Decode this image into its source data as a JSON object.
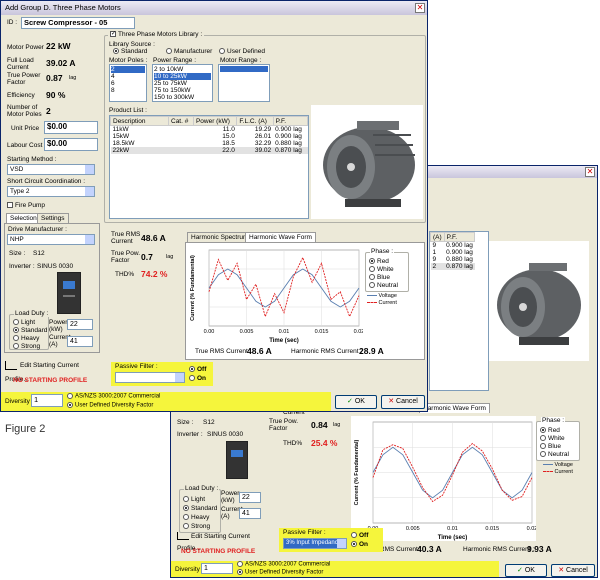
{
  "win1": {
    "title": "Add Group D. Three Phase Motors",
    "id_label": "ID :",
    "id_value": "Screw Compressor - 05",
    "motor_power_label": "Motor Power",
    "motor_power_value": "22 kW",
    "flc_label1": "Full Load",
    "flc_label2": "Current",
    "flc_value": "39.02 A",
    "tpf_label1": "True Power",
    "tpf_label2": "Factor",
    "tpf_value": "0.87",
    "tpf_unit": "lag",
    "eff_label": "Efficiency",
    "eff_value": "90 %",
    "nmp_label1": "Number of",
    "nmp_label2": "Motor Poles",
    "nmp_value": "2",
    "unit_price_label": "Unit Price",
    "unit_price_value": "$0.00",
    "labour_label": "Labour Cost",
    "labour_value": "$0.00",
    "starting_method_label": "Starting Method :",
    "starting_method_value": "VSD",
    "scc_label": "Short Circuit Coordination :",
    "scc_value": "Type 2",
    "fire_pump_label": "Fire Pump",
    "tab_selection": "Selection",
    "tab_settings": "Settings",
    "drive_mfr_label": "Drive Manufacturer :",
    "drive_mfr_value": "NHP",
    "size_label": "Size :",
    "size_value": "S12",
    "inverter_label": "Inverter :",
    "inverter_value": "SINUS 0030",
    "load_duty_label": "Load Duty :",
    "load_options": [
      "Light",
      "Standard",
      "Heavy",
      "Strong"
    ],
    "power_label1": "Power",
    "power_label2": "(kW)",
    "power_value": "22",
    "current_label1": "Current",
    "current_label2": "(A)",
    "current_value": "41",
    "edit_profile_label": "Edit Starting Current Profile...",
    "no_profile": "NO STARTING PROFILE",
    "library_check_label": "Three Phase Motors Library :",
    "library_source_label": "Library Source :",
    "lib_standard": "Standard",
    "lib_manufacturer": "Manufacturer",
    "lib_user": "User Defined",
    "motor_poles_label": "Motor Poles :",
    "motor_poles": [
      "2",
      "4",
      "6",
      "8"
    ],
    "power_range_label": "Power Range :",
    "power_ranges": [
      "2 to 10kW",
      "10 to 25kW",
      "25 to 75kW",
      "75 to 150kW",
      "150 to 300kW"
    ],
    "motor_range_label": "Motor Range :",
    "product_list_label": "Product List :",
    "table_headers": [
      "Description",
      "Cat. #",
      "Power (kW)",
      "F.L.C. (A)",
      "P.F."
    ],
    "table_rows": [
      [
        "11kW",
        "",
        "11.0",
        "19.29",
        "0.900 lag"
      ],
      [
        "15kW",
        "",
        "15.0",
        "26.01",
        "0.900 lag"
      ],
      [
        "18.5kW",
        "",
        "18.5",
        "32.29",
        "0.880 lag"
      ],
      [
        "22kW",
        "",
        "22.0",
        "39.02",
        "0.870 lag"
      ]
    ],
    "true_rms_label1": "True RMS",
    "true_rms_label2": "Current",
    "true_rms_value": "48.6 A",
    "true_pf_label1": "True Pow.",
    "true_pf_label2": "Factor",
    "true_pf_value": "0.7",
    "true_pf_unit": "lag",
    "thd_label": "THD%",
    "thd_value": "74.2 %",
    "tab_harmonic_spectrum": "Harmonic Spectrum",
    "tab_harmonic_wave": "Harmonic Wave Form",
    "phase_label": "Phase :",
    "phases": [
      "Red",
      "White",
      "Blue",
      "Neutral"
    ],
    "legend_voltage": "Voltage",
    "legend_current": "Current",
    "chart_ylabel": "Current (% Fundamental)",
    "chart_xlabel": "Time (sec)",
    "chart_x_ticks": [
      "0.00",
      "0.005",
      "0.01",
      "0.015",
      "0.02"
    ],
    "true_rms_current_label": "True RMS Current :",
    "true_rms_current_value": "48.6 A",
    "harm_rms_label": "Harmonic RMS Current :",
    "harm_rms_value": "28.9 A",
    "passive_filter_label": "Passive Filter :",
    "passive_filter_value": "",
    "off_label": "Off",
    "on_label": "On",
    "diversity_label": "Diversity",
    "diversity_value": "1",
    "div_opt1": "AS/NZS 3000:2007 Commercial",
    "div_opt2": "User Defined Diversity Factor",
    "ok_label": "OK",
    "cancel_label": "Cancel"
  },
  "figure_label": "Figure 2",
  "win2": {
    "tab_fragment": "d",
    "table_headers": [
      "(A)",
      "P.F."
    ],
    "table_rows": [
      [
        "9",
        "0.900 lag"
      ],
      [
        "1",
        "0.900 lag"
      ],
      [
        "9",
        "0.880 lag"
      ],
      [
        "2",
        "0.870 lag"
      ]
    ],
    "current_label": "Current",
    "tab_harmonic_wave": "Harmonic Wave Form",
    "true_pf_label1": "True Pow.",
    "true_pf_label2": "Factor",
    "true_pf_value": "0.84",
    "true_pf_unit": "lag",
    "thd_label": "THD%",
    "thd_value": "25.4 %",
    "size_label": "Size :",
    "size_value": "S12",
    "inverter_label": "Inverter :",
    "inverter_value": "SINUS 0030",
    "load_duty_label": "Load Duty :",
    "load_options": [
      "Light",
      "Standard",
      "Heavy",
      "Strong"
    ],
    "power_label1": "Power",
    "power_label2": "(kW)",
    "power_value": "22",
    "current_label1": "Current",
    "current_label2": "(A)",
    "current_value": "41",
    "edit_profile_label": "Edit Starting Current Profile...",
    "no_profile": "NO STARTING PROFILE",
    "phase_label": "Phase :",
    "phases": [
      "Red",
      "White",
      "Blue",
      "Neutral"
    ],
    "legend_voltage": "Voltage",
    "legend_current": "Current",
    "chart_ylabel": "Current (% Fundamental)",
    "chart_xlabel": "Time (sec)",
    "chart_x_ticks": [
      "0.00",
      "0.005",
      "0.01",
      "0.015",
      "0.02"
    ],
    "true_rms_current_label": "True RMS Current :",
    "true_rms_current_value": "40.3 A",
    "harm_rms_label": "Harmonic RMS Current :",
    "harm_rms_value": "9.93 A",
    "passive_filter_label": "Passive Filter :",
    "passive_filter_value": "3% Input Impedance",
    "off_label": "Off",
    "on_label": "On",
    "diversity_label": "Diversity",
    "diversity_value": "1",
    "div_opt1": "AS/NZS 3000:2007 Commercial",
    "div_opt2": "User Defined Diversity Factor",
    "ok_label": "OK",
    "cancel_label": "Cancel"
  },
  "colors": {
    "accent_yellow": "#f5f53c",
    "voltage": "#5a7fb0",
    "current": "#e02020",
    "highlight": "#316ac5"
  },
  "chart_data": [
    {
      "type": "line",
      "x": [
        0,
        0.00125,
        0.0025,
        0.00375,
        0.005,
        0.00625,
        0.0075,
        0.00875,
        0.01,
        0.01125,
        0.0125,
        0.01375,
        0.015,
        0.01625,
        0.0175,
        0.01875,
        0.02
      ],
      "series": [
        {
          "name": "Voltage",
          "values": [
            0,
            70,
            100,
            70,
            0,
            -70,
            -100,
            -70,
            0,
            70,
            100,
            70,
            0,
            -70,
            -100,
            -70,
            0
          ]
        },
        {
          "name": "Current",
          "values": [
            -20,
            150,
            40,
            130,
            -60,
            20,
            -150,
            -30,
            -130,
            60,
            160,
            30,
            130,
            -60,
            -20,
            -150,
            -40
          ]
        }
      ],
      "xlabel": "Time (sec)",
      "ylabel": "Current (% Fundamental)",
      "xlim": [
        0,
        0.02
      ],
      "ylim": [
        -200,
        200
      ]
    },
    {
      "type": "line",
      "x": [
        0,
        0.00125,
        0.0025,
        0.00375,
        0.005,
        0.00625,
        0.0075,
        0.00875,
        0.01,
        0.01125,
        0.0125,
        0.01375,
        0.015,
        0.01625,
        0.0175,
        0.01875,
        0.02
      ],
      "series": [
        {
          "name": "Voltage",
          "values": [
            0,
            70,
            100,
            70,
            0,
            -70,
            -100,
            -70,
            0,
            70,
            100,
            70,
            0,
            -70,
            -100,
            -70,
            0
          ]
        },
        {
          "name": "Current",
          "values": [
            -20,
            90,
            110,
            95,
            20,
            -60,
            -115,
            -90,
            -10,
            80,
            115,
            85,
            15,
            -70,
            -110,
            -95,
            -20
          ]
        }
      ],
      "xlabel": "Time (sec)",
      "ylabel": "Current (% Fundamental)",
      "xlim": [
        0,
        0.02
      ],
      "ylim": [
        -200,
        200
      ]
    }
  ]
}
